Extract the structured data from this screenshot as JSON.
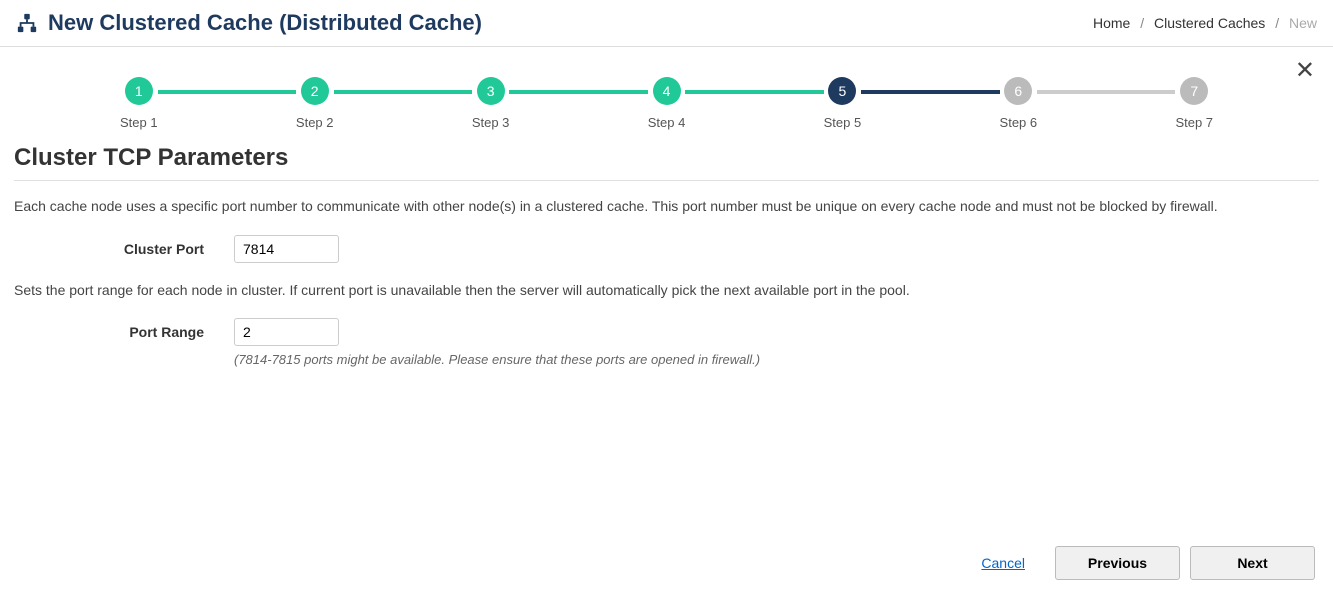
{
  "header": {
    "title": "New Clustered Cache (Distributed Cache)",
    "breadcrumb": {
      "home": "Home",
      "mid": "Clustered Caches",
      "current": "New"
    }
  },
  "stepper": {
    "steps": [
      {
        "num": "1",
        "label": "Step 1",
        "state": "done"
      },
      {
        "num": "2",
        "label": "Step 2",
        "state": "done"
      },
      {
        "num": "3",
        "label": "Step 3",
        "state": "done"
      },
      {
        "num": "4",
        "label": "Step 4",
        "state": "done"
      },
      {
        "num": "5",
        "label": "Step 5",
        "state": "active"
      },
      {
        "num": "6",
        "label": "Step 6",
        "state": "pending"
      },
      {
        "num": "7",
        "label": "Step 7",
        "state": "pending"
      }
    ],
    "connectors": [
      "done",
      "done",
      "done",
      "done",
      "active",
      "pending"
    ]
  },
  "section": {
    "title": "Cluster TCP Parameters",
    "desc1": "Each cache node uses a specific port number to communicate with other node(s) in a clustered cache. This port number must be unique on every cache node and must not be blocked by firewall.",
    "cluster_port_label": "Cluster Port",
    "cluster_port_value": "7814",
    "desc2": "Sets the port range for each node in cluster. If current port is unavailable then the server will automatically pick the next available port in the pool.",
    "port_range_label": "Port Range",
    "port_range_value": "2",
    "hint": "(7814-7815 ports might be available. Please ensure that these ports are opened in firewall.)"
  },
  "footer": {
    "cancel": "Cancel",
    "previous": "Previous",
    "next": "Next"
  }
}
